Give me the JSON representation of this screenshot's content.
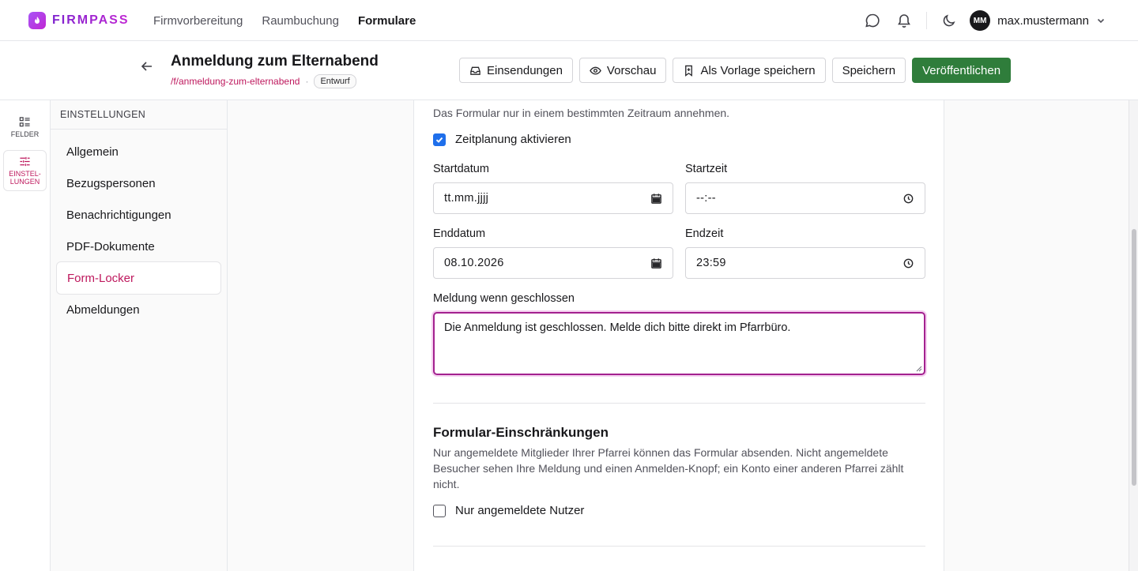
{
  "brand": {
    "name": "FIRMPASS"
  },
  "nav": {
    "links": [
      {
        "label": "Firmvorbereitung",
        "active": false
      },
      {
        "label": "Raumbuchung",
        "active": false
      },
      {
        "label": "Formulare",
        "active": true
      }
    ],
    "user": {
      "initials": "MM",
      "name": "max.mustermann"
    }
  },
  "header": {
    "title": "Anmeldung zum Elternabend",
    "slug": "/f/anmeldung-zum-elternabend",
    "separator": "·",
    "status": "Entwurf",
    "actions": {
      "submissions": "Einsendungen",
      "preview": "Vorschau",
      "save_template": "Als Vorlage speichern",
      "save": "Speichern",
      "publish": "Veröffentlichen"
    }
  },
  "rail": {
    "fields": "FELDER",
    "settings_line1": "EINSTEL-",
    "settings_line2": "LUNGEN"
  },
  "settings": {
    "heading": "EINSTELLUNGEN",
    "items": [
      {
        "label": "Allgemein",
        "active": false
      },
      {
        "label": "Bezugspersonen",
        "active": false
      },
      {
        "label": "Benachrichtigungen",
        "active": false
      },
      {
        "label": "PDF-Dokumente",
        "active": false
      },
      {
        "label": "Form-Locker",
        "active": true
      },
      {
        "label": "Abmeldungen",
        "active": false
      }
    ]
  },
  "schedule": {
    "description": "Das Formular nur in einem bestimmten Zeitraum annehmen.",
    "enable_label": "Zeitplanung aktivieren",
    "enabled": true,
    "start_date_label": "Startdatum",
    "start_date_value": "tt.mm.jjjj",
    "start_time_label": "Startzeit",
    "start_time_value": "--:--",
    "end_date_label": "Enddatum",
    "end_date_value": "08.10.2026",
    "end_time_label": "Endzeit",
    "end_time_value": "23:59",
    "closed_message_label": "Meldung wenn geschlossen",
    "closed_message_value": "Die Anmeldung ist geschlossen. Melde dich bitte direkt im Pfarrbüro."
  },
  "restrictions": {
    "title": "Formular-Einschränkungen",
    "description": "Nur angemeldete Mitglieder Ihrer Pfarrei können das Formular absenden. Nicht angemeldete Besucher sehen Ihre Meldung und einen Anmelden-Knopf; ein Konto einer anderen Pfarrei zählt nicht.",
    "logged_in_only_label": "Nur angemeldete Nutzer",
    "logged_in_only": false
  },
  "colors": {
    "accent": "#be185d",
    "publish": "#2f7d3b",
    "checkbox": "#1f6feb",
    "focus": "#a3218f"
  }
}
